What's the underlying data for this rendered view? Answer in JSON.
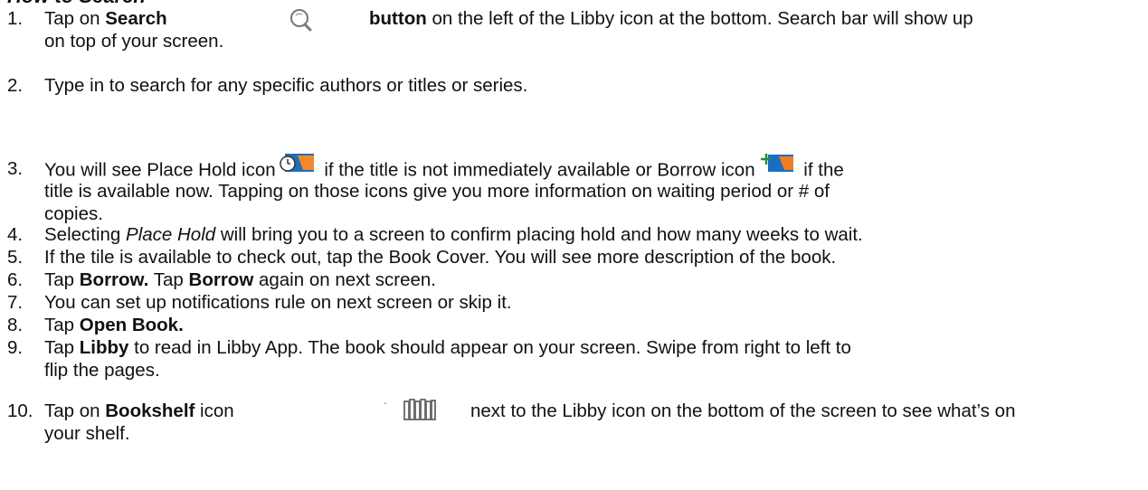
{
  "heading": "How to Search",
  "steps": [
    {
      "num": "1.",
      "a": "Tap on ",
      "b1": "Search",
      "c": "button",
      "d": " on the left of the Libby icon at the bottom. Search bar will show up",
      "e": "on top of your screen."
    },
    {
      "num": "2.",
      "a": "Type in to search for any specific authors or titles or series."
    },
    {
      "num": "3.",
      "a": "You will see Place Hold icon",
      "b": " if the title is not immediately available or Borrow icon",
      "c": " if the",
      "d": "title is available now. Tapping on those icons give you more information on waiting period or # of",
      "e": "copies."
    },
    {
      "num": "4.",
      "a": "Selecting ",
      "i": "Place Hold",
      "b": " will bring you to a screen to confirm placing hold and how many weeks to wait."
    },
    {
      "num": "5.",
      "a": "If the tile is available to check out, tap the Book Cover. You will see more description of the book."
    },
    {
      "num": "6.",
      "a": "Tap ",
      "b1": "Borrow.",
      "c": " Tap ",
      "b2": "Borrow",
      "d": " again on next screen."
    },
    {
      "num": "7.",
      "a": "You can set up notifications rule on next screen or skip it."
    },
    {
      "num": "8.",
      "a": "Tap ",
      "b1": "Open Book."
    },
    {
      "num": "9.",
      "a": "Tap ",
      "b1": "Libby",
      "c": " to read in Libby App. The book should appear on your screen. Swipe from right to left to",
      "d": "flip the pages."
    },
    {
      "num": "10.",
      "a": "Tap on ",
      "b1": "Bookshelf",
      "c": " icon",
      "d": "next to the Libby icon on the bottom of the screen to see what’s on",
      "e": "your shelf."
    }
  ],
  "icons": {
    "search": "magnifier-icon",
    "place_hold": "place-hold-icon",
    "borrow": "borrow-icon",
    "bookshelf": "bookshelf-icon"
  },
  "colors": {
    "hold_blue": "#1f6fb8",
    "hold_orange": "#f2882c",
    "borrow_blue": "#1a6ec2",
    "borrow_orange": "#ef7d22"
  }
}
